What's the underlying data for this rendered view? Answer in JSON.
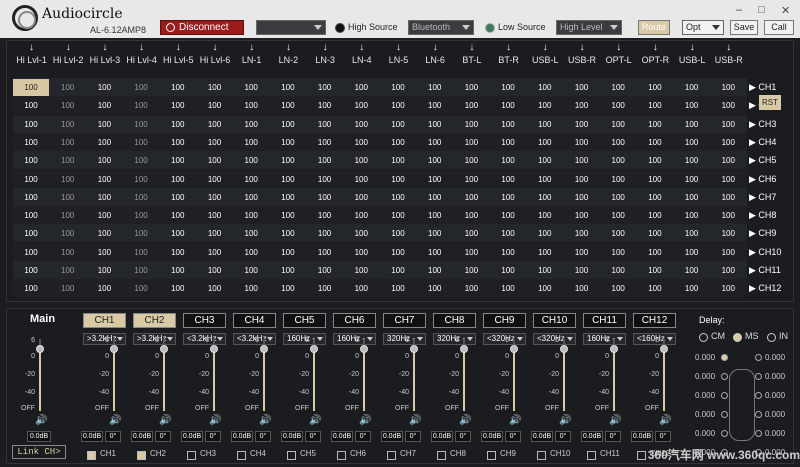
{
  "app": {
    "brand": "Audiocircle",
    "model": "AL-6.12AMP8",
    "disconnect": "Disconnect",
    "blank_select": "",
    "high_source": "High Source",
    "bluetooth": "Bluetooth",
    "low_source": "Low Source",
    "high_level": "High Level",
    "route": "Route",
    "opt": "Opt",
    "save": "Save",
    "call": "Call",
    "min": "–",
    "max": "□",
    "close": "✕"
  },
  "colors": {
    "accent": "#d9caa6",
    "disconnect": "#9b1c1c"
  },
  "matrix": {
    "inputs": [
      "Hi Lvl-1",
      "Hi Lvl-2",
      "Hi Lvl-3",
      "Hi Lvl-4",
      "Hi Lvl-5",
      "Hi Lvl-6",
      "LN-1",
      "LN-2",
      "LN-3",
      "LN-4",
      "LN-5",
      "LN-6",
      "BT-L",
      "BT-R",
      "USB-L",
      "USB-R",
      "OPT-L",
      "OPT-R",
      "USB-L",
      "USB-R"
    ],
    "outputs": [
      "CH1",
      "CH2",
      "CH3",
      "CH4",
      "CH5",
      "CH6",
      "CH7",
      "CH8",
      "CH9",
      "CH10",
      "CH11",
      "CH12"
    ],
    "cell_value": "100",
    "rst": "RST"
  },
  "mixer": {
    "main_label": "Main",
    "scale": [
      "6",
      "0",
      "-20",
      "-40",
      "OFF"
    ],
    "main_value": "0.0dB",
    "link": "Link CH>",
    "channels": [
      {
        "name": "CH1",
        "filter": ">3.2kHz",
        "gain": "0.0dB",
        "phase": "0°",
        "checked": true
      },
      {
        "name": "CH2",
        "filter": ">3.2kHz",
        "gain": "0.0dB",
        "phase": "0°",
        "checked": true
      },
      {
        "name": "CH3",
        "filter": "<3.2kHz",
        "gain": "0.0dB",
        "phase": "0°",
        "checked": false
      },
      {
        "name": "CH4",
        "filter": "<3.2kHz",
        "gain": "0.0dB",
        "phase": "0°",
        "checked": false
      },
      {
        "name": "CH5",
        "filter": "160Hz -",
        "gain": "0.0dB",
        "phase": "0°",
        "checked": false
      },
      {
        "name": "CH6",
        "filter": "160Hz -",
        "gain": "0.0dB",
        "phase": "0°",
        "checked": false
      },
      {
        "name": "CH7",
        "filter": "320Hz -",
        "gain": "0.0dB",
        "phase": "0°",
        "checked": false
      },
      {
        "name": "CH8",
        "filter": "320Hz -",
        "gain": "0.0dB",
        "phase": "0°",
        "checked": false
      },
      {
        "name": "CH9",
        "filter": "<320Hz",
        "gain": "0.0dB",
        "phase": "0°",
        "checked": false
      },
      {
        "name": "CH10",
        "filter": "<320Hz",
        "gain": "0.0dB",
        "phase": "0°",
        "checked": false
      },
      {
        "name": "CH11",
        "filter": "160Hz -",
        "gain": "0.0dB",
        "phase": "0°",
        "checked": false
      },
      {
        "name": "CH12",
        "filter": "<160Hz",
        "gain": "0.0dB",
        "phase": "0°",
        "checked": false
      }
    ]
  },
  "delay": {
    "title": "Delay:",
    "cm": "CM",
    "ms": "MS",
    "in": "IN",
    "values": [
      "0.000",
      "0.000",
      "0.000",
      "0.000",
      "0.000",
      "0.000",
      "0.000",
      "0.000",
      "0.000",
      "0.000",
      "0.000",
      "0.000"
    ]
  },
  "watermark": "360汽车网 www.360qc.com"
}
